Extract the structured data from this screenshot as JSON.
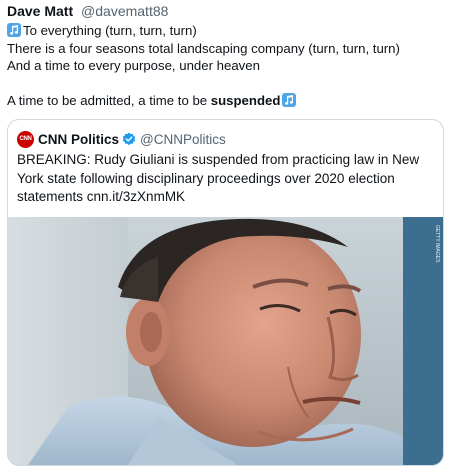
{
  "tweet": {
    "display_name": "Dave Matt",
    "handle": "@davematt88",
    "lines": [
      "To everything (turn, turn, turn)",
      "There is a four seasons total landscaping company (turn, turn, turn)",
      "And a time to every purpose, under heaven"
    ],
    "last_line_prefix": "A time to be admitted, a time to be ",
    "last_line_bold": "suspended",
    "emoji_icon": "musical-notes-icon"
  },
  "quoted": {
    "display_name": "CNN Politics",
    "handle": "@CNNPolitics",
    "logo_text": "CNN",
    "text": "BREAKING: Rudy Giuliani is suspended from practicing law in New York state following disciplinary proceedings over 2020 election statements cnn.it/3zXnmMK",
    "image_alt": "Close-up photo of Rudy Giuliani",
    "image_credit": "GETTY IMAGES"
  },
  "colors": {
    "verified": "#1d9bf0",
    "cnn_red": "#cc0000",
    "emoji_blue": "#4ea6e8"
  }
}
